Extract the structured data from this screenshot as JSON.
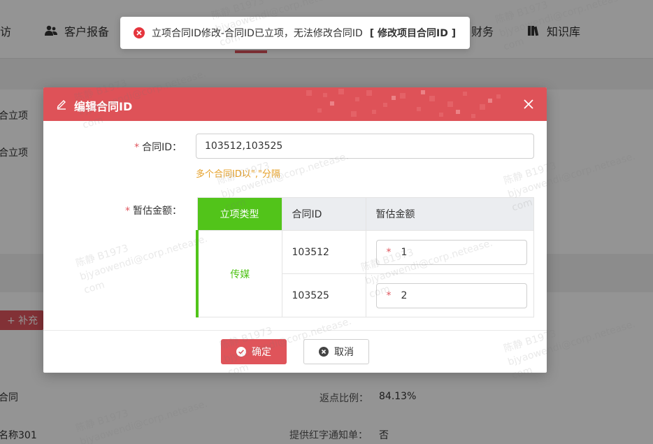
{
  "nav": {
    "items": [
      {
        "label": "访"
      },
      {
        "label": "客户报备"
      },
      {
        "label": "财务"
      },
      {
        "label": "知识库"
      }
    ]
  },
  "background": {
    "left_items": [
      "合立项",
      "合立项"
    ],
    "add_button": "+ 补充",
    "bottom_left": [
      "合同",
      "名称301"
    ],
    "rebate_label": "返点比例：",
    "rebate_value": "84.13%",
    "redletter_label": "提供红字通知单：",
    "redletter_value": "否"
  },
  "toast": {
    "message": "立项合同ID修改-合同ID已立项，无法修改合同ID",
    "link": "[ 修改项目合同ID ]"
  },
  "modal": {
    "title": "编辑合同ID",
    "contract_label": "合同ID：",
    "contract_value": "103512,103525",
    "hint": "多个合同ID以\",\"分隔",
    "amount_label": "暂估金额：",
    "table": {
      "headers": [
        "立项类型",
        "合同ID",
        "暂估金额"
      ],
      "type_value": "传媒",
      "rows": [
        {
          "contract_id": "103512",
          "amount": "1"
        },
        {
          "contract_id": "103525",
          "amount": "2"
        }
      ]
    },
    "ok_label": "确定",
    "cancel_label": "取消"
  },
  "watermark": {
    "name": "陈静 B1973",
    "email": "bjyaowendi@corp.netease.",
    "domain": "com"
  },
  "colors": {
    "brand_red": "#de5258",
    "green": "#52c41a",
    "hint_orange": "#e6a12a"
  }
}
